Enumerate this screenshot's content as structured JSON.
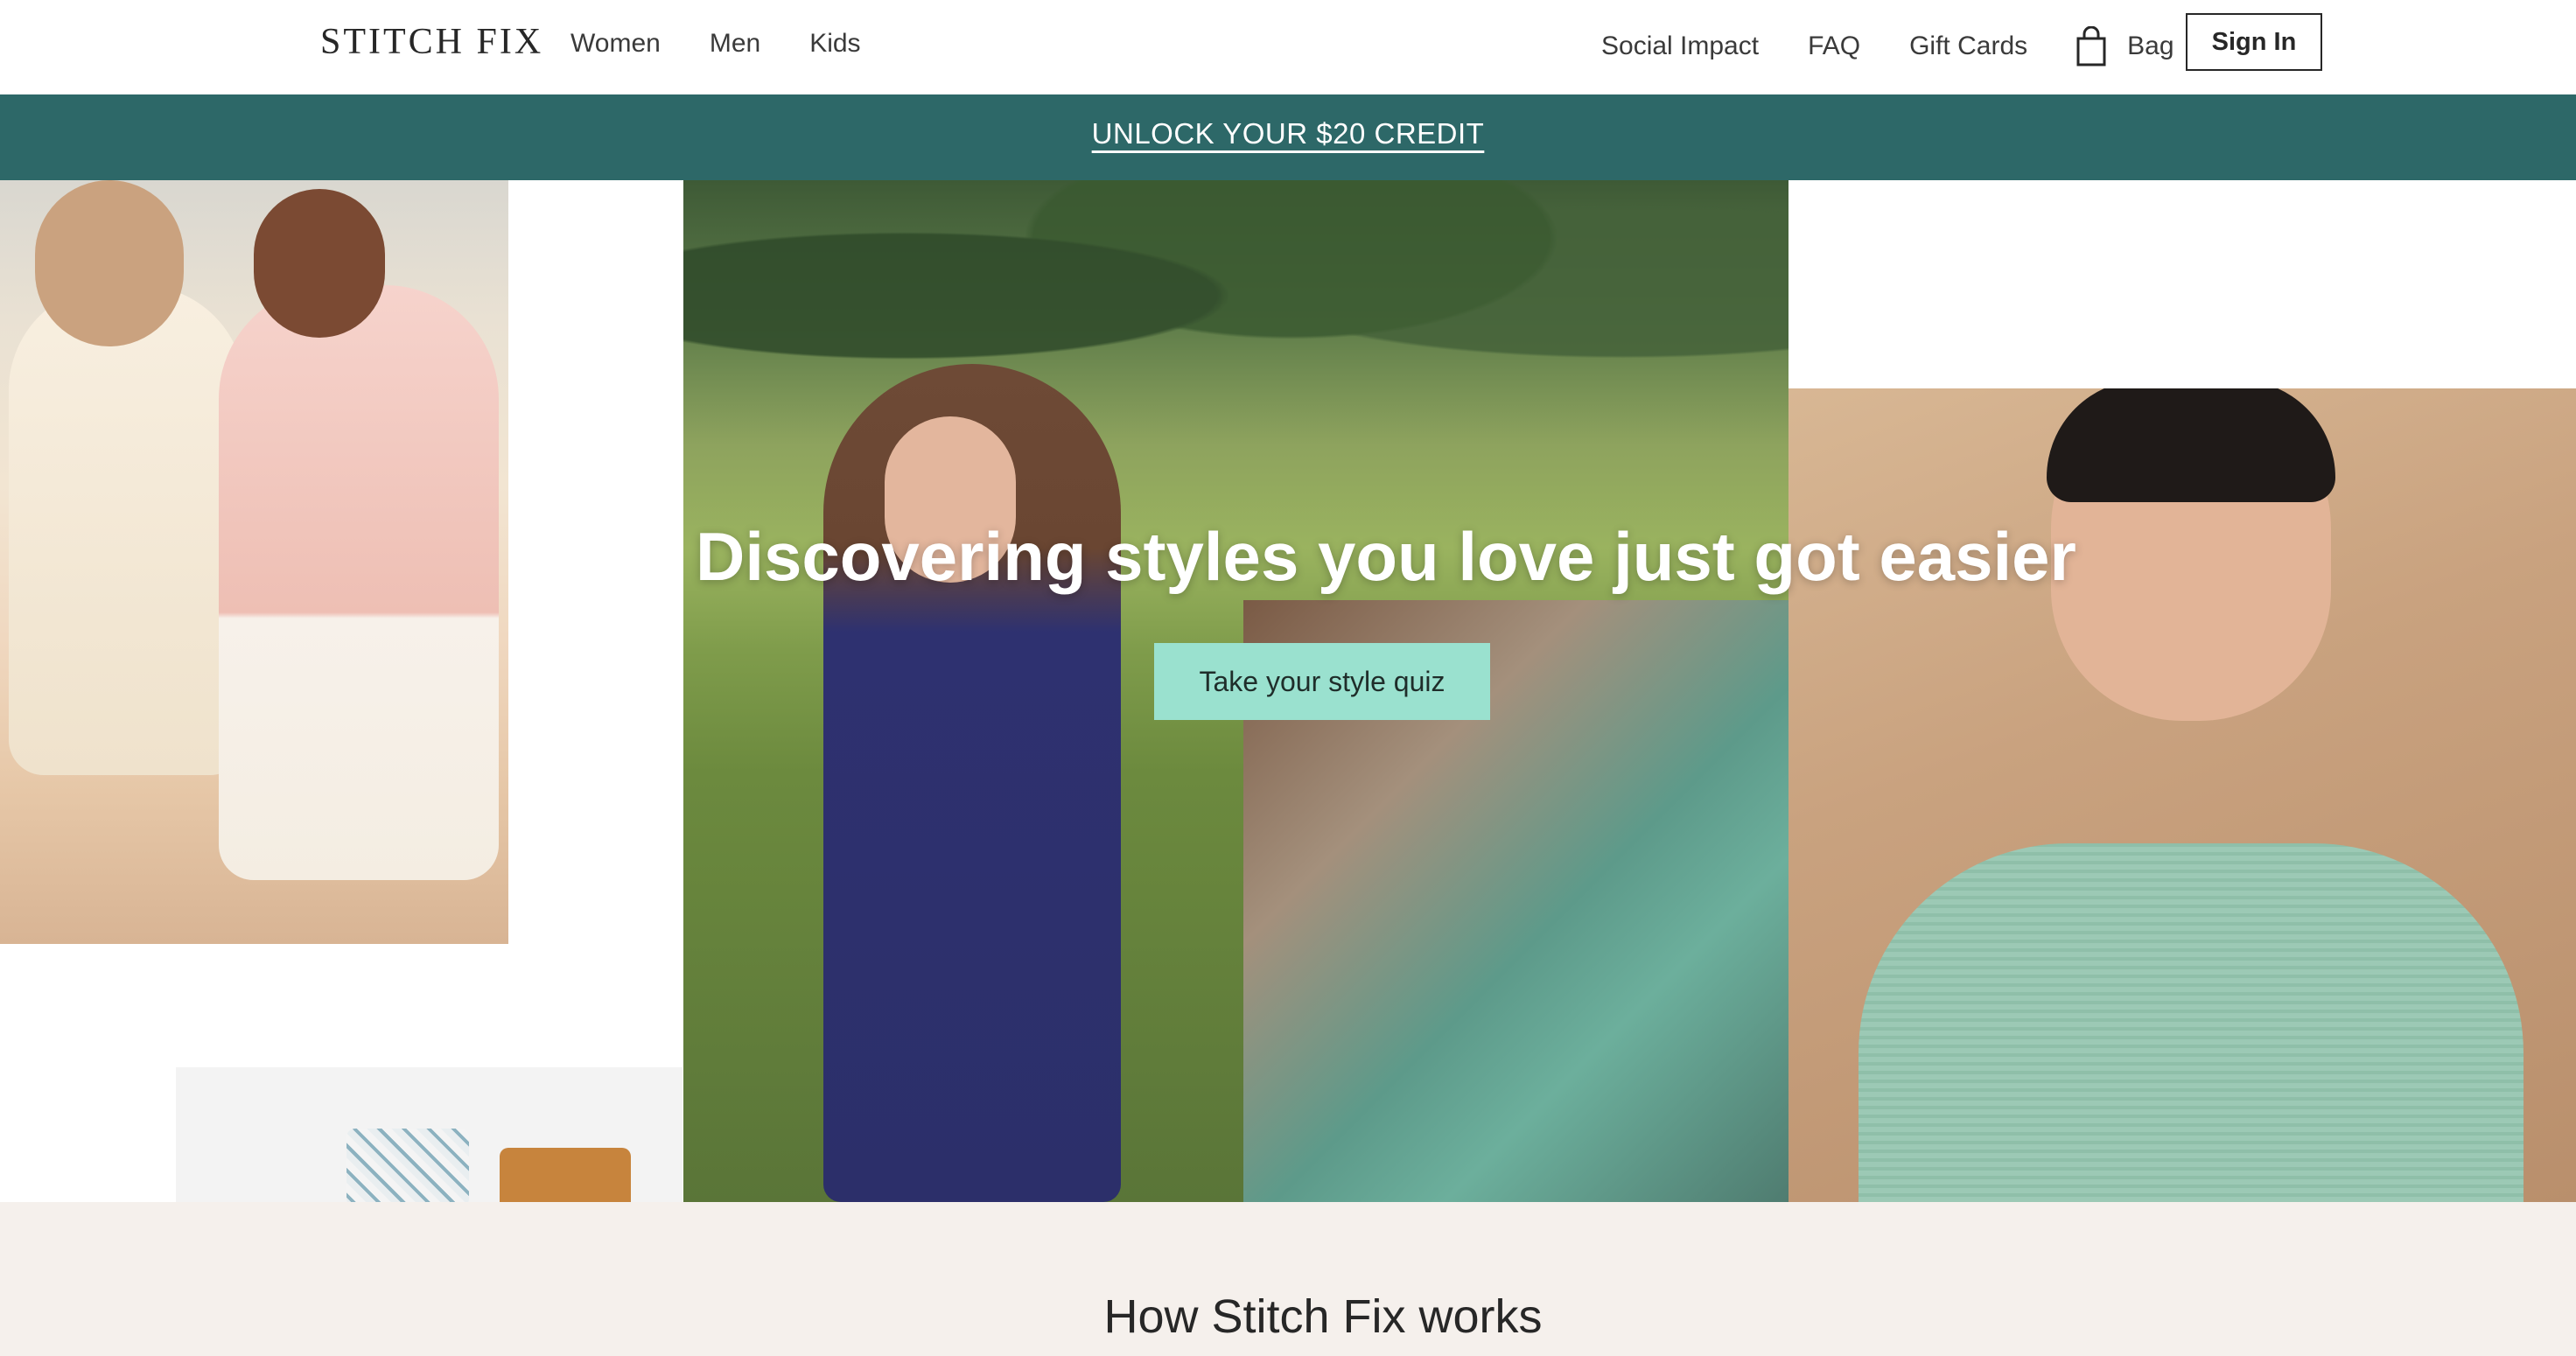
{
  "header": {
    "logo": "STITCH FIX",
    "nav_left": [
      "Women",
      "Men",
      "Kids"
    ],
    "nav_right": [
      "Social Impact",
      "FAQ",
      "Gift Cards"
    ],
    "bag_label": "Bag",
    "bag_icon": "shopping-bag-icon",
    "signin_label": "Sign In"
  },
  "promo": {
    "text": "UNLOCK YOUR $20 CREDIT",
    "background": "#2d6868"
  },
  "hero": {
    "title": "Discovering styles you love just got easier",
    "cta_label": "Take your style quiz",
    "cta_color": "#9ae1cf"
  },
  "how_it_works": {
    "title": "How Stitch Fix works",
    "background": "#f5f0ec"
  }
}
